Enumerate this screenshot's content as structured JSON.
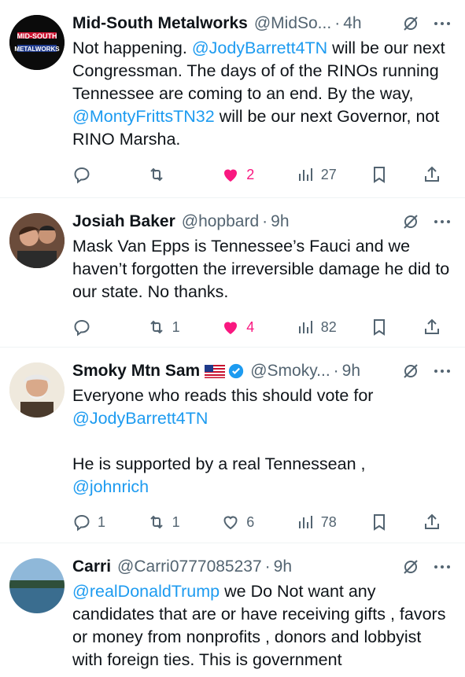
{
  "tweets": [
    {
      "name": "Mid-South Metalworks",
      "handle": "@MidSo...",
      "time": "4h",
      "avatar_text": "MID-SOUTH METALWORKS",
      "text_parts": [
        {
          "t": "Not happening. ",
          "m": false
        },
        {
          "t": "@JodyBarrett4TN",
          "m": true
        },
        {
          "t": " will be our next Congressman. The days of of the RINOs running Tennessee are coming to an end. By the way, ",
          "m": false
        },
        {
          "t": "@MontyFrittsTN32",
          "m": true
        },
        {
          "t": " will be our next Governor, not RINO Marsha.",
          "m": false
        }
      ],
      "replies": "",
      "retweets": "",
      "likes": "2",
      "views": "27",
      "liked": true
    },
    {
      "name": "Josiah Baker",
      "handle": "@hopbard",
      "time": "9h",
      "text_parts": [
        {
          "t": "Mask Van Epps is Tennessee’s Fauci and we haven’t forgotten the irreversible damage he did to our state. No thanks.",
          "m": false
        }
      ],
      "replies": "",
      "retweets": "1",
      "likes": "4",
      "views": "82",
      "liked": true
    },
    {
      "name": "Smoky Mtn Sam",
      "handle": "@Smoky...",
      "time": "9h",
      "text_parts": [
        {
          "t": "Everyone who reads this should vote for ",
          "m": false
        },
        {
          "t": "@JodyBarrett4TN",
          "m": true
        },
        {
          "t": "\n\nHe is supported by a real Tennessean ,\n",
          "m": false
        },
        {
          "t": "@johnrich",
          "m": true
        }
      ],
      "replies": "1",
      "retweets": "1",
      "likes": "6",
      "views": "78",
      "liked": false
    },
    {
      "name": "Carri",
      "handle": "@Carri0777085237",
      "time": "9h",
      "text_parts": [
        {
          "t": "@realDonaldTrump",
          "m": true
        },
        {
          "t": " we Do Not want any candidates that are or have receiving gifts , favors or money from nonprofits , donors and lobbyist with foreign ties. This is government",
          "m": false
        }
      ]
    }
  ],
  "colors": {
    "accent": "#1d9bf0",
    "like": "#f91880",
    "muted": "#536471"
  }
}
